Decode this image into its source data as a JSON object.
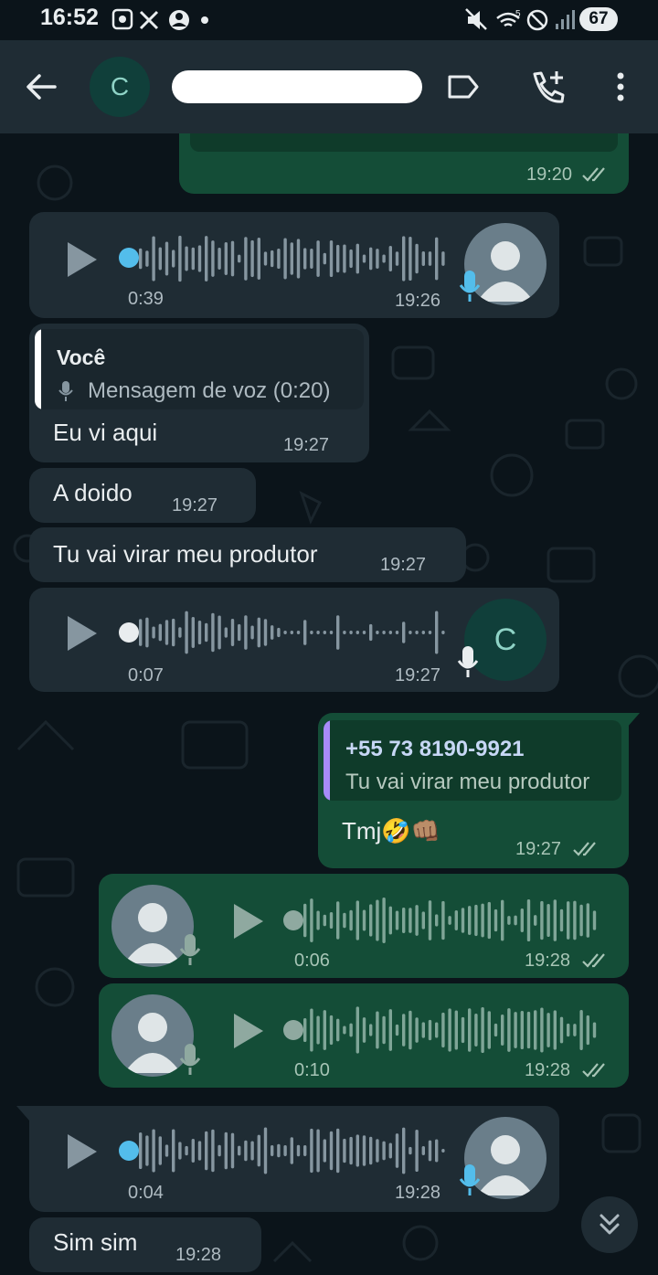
{
  "status_bar": {
    "time": "16:52",
    "battery": "67",
    "signal_label": "5"
  },
  "header": {
    "avatar_letter": "C",
    "contact_name": ""
  },
  "messages": [
    {
      "type": "text",
      "direction": "out",
      "time": "19:20",
      "ticks": "read"
    },
    {
      "type": "voice",
      "direction": "in",
      "duration": "0:39",
      "time": "19:26",
      "avatar": "default"
    },
    {
      "type": "text_reply",
      "direction": "in",
      "quote_author": "Você",
      "quote_text": "Mensagem de voz (0:20)",
      "text": "Eu vi aqui",
      "time": "19:27"
    },
    {
      "type": "text",
      "direction": "in",
      "text": "A doido",
      "time": "19:27"
    },
    {
      "type": "text",
      "direction": "in",
      "text": "Tu vai virar meu produtor",
      "time": "19:27"
    },
    {
      "type": "voice",
      "direction": "in",
      "duration": "0:07",
      "time": "19:27",
      "avatar_letter": "C"
    },
    {
      "type": "text_reply",
      "direction": "out",
      "quote_author": "+55 73 8190-9921",
      "quote_text": "Tu vai virar meu produtor",
      "text": "Tmj🤣👊🏽",
      "time": "19:27",
      "ticks": "read"
    },
    {
      "type": "voice",
      "direction": "out",
      "duration": "0:06",
      "time": "19:28",
      "ticks": "read"
    },
    {
      "type": "voice",
      "direction": "out",
      "duration": "0:10",
      "time": "19:28",
      "ticks": "read"
    },
    {
      "type": "voice",
      "direction": "in",
      "duration": "0:04",
      "time": "19:28",
      "avatar": "default"
    },
    {
      "type": "text",
      "direction": "in",
      "text": "Sim sim",
      "time": "19:28"
    }
  ],
  "colors": {
    "background": "#0b141a",
    "header": "#1f2c34",
    "incoming": "#1f2c34",
    "outgoing": "#144d37",
    "voice_dot_unplayed": "#53bdeb",
    "quote_you": "#a78bfa",
    "quote_contact": "#a78bfa"
  }
}
